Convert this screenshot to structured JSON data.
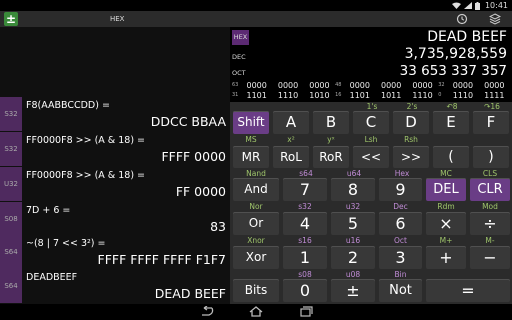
{
  "status_bar": {
    "time": "10:41"
  },
  "action_bar": {
    "app_icon_glyph": "±",
    "mode_title": "HEX"
  },
  "history": [
    {
      "tag": "S32",
      "expr": "F8(AABBCCDD) =",
      "result": "DDCC BBAA"
    },
    {
      "tag": "S32",
      "expr": "FF0000F8 >> (A & 18) =",
      "result": "FFFF 0000"
    },
    {
      "tag": "U32",
      "expr": "FF0000F8 >> (A & 18) =",
      "result": "FF 0000"
    },
    {
      "tag": "S08",
      "expr": "7D + 6 =",
      "result": "83"
    },
    {
      "tag": "S64",
      "expr": "~(8 | 7 << 3²) =",
      "result": "FFFF FFFF FFFF F1F7"
    },
    {
      "tag": "S64",
      "expr": "DEADBEEF",
      "result": "DEAD BEEF"
    }
  ],
  "display": {
    "hex_tag": "HEX",
    "hex_value": "DEAD BEEF",
    "dec_tag": "DEC",
    "dec_value": "3,735,928,559",
    "oct_tag": "OCT",
    "oct_value": "33 653 337 357",
    "bin_row1": {
      "n1": "63",
      "g1": "0000",
      "g2": "0000",
      "g3": "0000",
      "n2": "48",
      "g4": "0000",
      "g5": "0000",
      "g6": "0000",
      "n3": "32",
      "g7": "0000",
      "g8": "0000"
    },
    "bin_row2": {
      "n1": "31",
      "g1": "1101",
      "g2": "1110",
      "g3": "1010",
      "n2": "16",
      "g4": "1101",
      "g5": "1011",
      "g6": "1110",
      "n3": "0",
      "g7": "1110",
      "g8": "1111"
    }
  },
  "keypad": {
    "labels": {
      "ones": "1's",
      "twos": "2's",
      "rotl_small": "↶8",
      "rotr_small": "↷16",
      "ms": "MS",
      "x2": "x²",
      "yx": "yˣ",
      "lsh": "Lsh",
      "rsh": "Rsh",
      "nand": "Nand",
      "s64": "s64",
      "u64": "u64",
      "hex": "Hex",
      "mc": "MC",
      "cls": "CLS",
      "nor": "Nor",
      "s32": "s32",
      "u32": "u32",
      "dec": "Dec",
      "rdm": "Rdm",
      "mod": "Mod",
      "xnor": "Xnor",
      "s16": "s16",
      "u16": "u16",
      "oct": "Oct",
      "mplus": "M+",
      "mminus": "M-",
      "s08": "s08",
      "u08": "u08",
      "bin": "Bin"
    },
    "keys": {
      "shift": "Shift",
      "a": "A",
      "b": "B",
      "c": "C",
      "d": "D",
      "e": "E",
      "f": "F",
      "mr": "MR",
      "rol": "RoL",
      "ror": "RoR",
      "lshift": "<<",
      "rshift": ">>",
      "lparen": "(",
      "rparen": ")",
      "and": "And",
      "seven": "7",
      "eight": "8",
      "nine": "9",
      "del": "DEL",
      "clr": "CLR",
      "or": "Or",
      "four": "4",
      "five": "5",
      "six": "6",
      "mul": "×",
      "div": "÷",
      "xor": "Xor",
      "one": "1",
      "two": "2",
      "three": "3",
      "plus": "+",
      "minus": "−",
      "bits": "Bits",
      "zero": "0",
      "neg": "±",
      "not": "Not",
      "eq": "="
    }
  },
  "colors": {
    "accent_purple": "#6a3d86",
    "label_green": "#9fc56b",
    "label_purple": "#c08cd6",
    "keypad_bg": "#2b2b2b"
  }
}
